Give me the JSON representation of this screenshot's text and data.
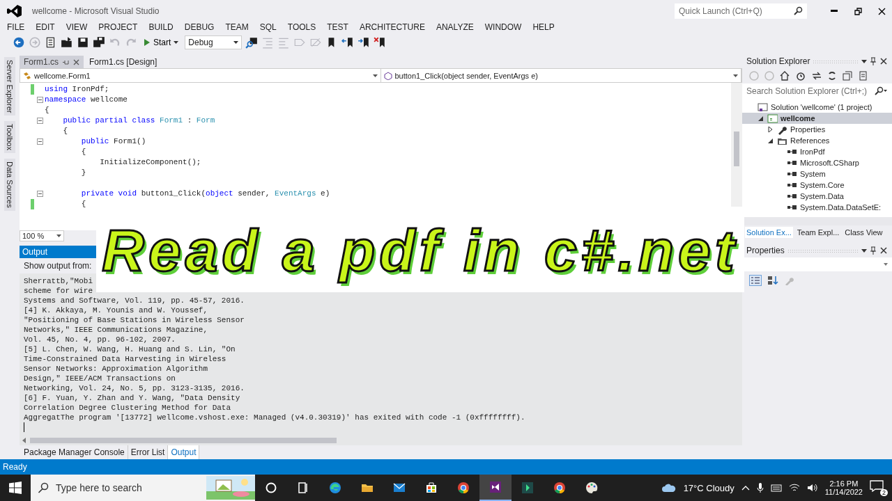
{
  "window": {
    "title": "wellcome - Microsoft Visual Studio",
    "quick_launch": {
      "placeholder": "Quick Launch (Ctrl+Q)"
    }
  },
  "menu": [
    "FILE",
    "EDIT",
    "VIEW",
    "PROJECT",
    "BUILD",
    "DEBUG",
    "TEAM",
    "SQL",
    "TOOLS",
    "TEST",
    "ARCHITECTURE",
    "ANALYZE",
    "WINDOW",
    "HELP"
  ],
  "toolbar": [
    {
      "kind": "back",
      "disabled": false
    },
    {
      "kind": "forward",
      "disabled": true
    },
    {
      "kind": "new-project",
      "disabled": false
    },
    {
      "kind": "open",
      "disabled": false
    },
    {
      "kind": "save",
      "disabled": false
    },
    {
      "kind": "save-all",
      "disabled": false
    },
    {
      "kind": "undo",
      "disabled": true
    },
    {
      "kind": "redo",
      "disabled": true
    },
    {
      "kind": "start",
      "label": "Start"
    },
    {
      "kind": "config",
      "value": "Debug"
    },
    {
      "kind": "find",
      "disabled": false
    },
    {
      "kind": "indent",
      "disabled": true
    },
    {
      "kind": "outdent",
      "disabled": true
    },
    {
      "kind": "comment",
      "disabled": true
    },
    {
      "kind": "uncomment",
      "disabled": true
    },
    {
      "kind": "bookmark",
      "disabled": false
    },
    {
      "kind": "bookmark-prev",
      "disabled": false
    },
    {
      "kind": "bookmark-next",
      "disabled": false
    },
    {
      "kind": "bookmark-clear",
      "disabled": false
    }
  ],
  "side_tabs": [
    "Server Explorer",
    "Toolbox",
    "Data Sources"
  ],
  "editor": {
    "tabs": [
      {
        "label": "Form1.cs",
        "selected": true
      },
      {
        "label": "Form1.cs [Design]",
        "selected": false
      }
    ],
    "type_dropdown": "wellcome.Form1",
    "member_dropdown": "button1_Click(object sender, EventArgs e)",
    "lines": [
      {
        "changed": true,
        "fold": false,
        "tokens": [
          {
            "text": "using",
            "kind": "keyword"
          },
          {
            "text": " IronPdf;",
            "kind": "plain"
          }
        ]
      },
      {
        "changed": false,
        "fold": true,
        "tokens": [
          {
            "text": "namespace",
            "kind": "keyword"
          },
          {
            "text": " wellcome",
            "kind": "plain"
          }
        ]
      },
      {
        "changed": false,
        "fold": false,
        "tokens": [
          {
            "text": "{",
            "kind": "plain"
          }
        ]
      },
      {
        "changed": false,
        "fold": true,
        "tokens": [
          {
            "text": "    public partial class ",
            "kind": "keyword"
          },
          {
            "text": "Form1",
            "kind": "type"
          },
          {
            "text": " : ",
            "kind": "plain"
          },
          {
            "text": "Form",
            "kind": "type"
          }
        ]
      },
      {
        "changed": false,
        "fold": false,
        "tokens": [
          {
            "text": "    {",
            "kind": "plain"
          }
        ]
      },
      {
        "changed": false,
        "fold": true,
        "tokens": [
          {
            "text": "        public ",
            "kind": "keyword"
          },
          {
            "text": "Form1()",
            "kind": "plain"
          }
        ]
      },
      {
        "changed": false,
        "fold": false,
        "tokens": [
          {
            "text": "        {",
            "kind": "plain"
          }
        ]
      },
      {
        "changed": false,
        "fold": false,
        "tokens": [
          {
            "text": "            InitializeComponent();",
            "kind": "plain"
          }
        ]
      },
      {
        "changed": false,
        "fold": false,
        "tokens": [
          {
            "text": "        }",
            "kind": "plain"
          }
        ]
      },
      {
        "changed": false,
        "fold": false
      },
      {
        "changed": false,
        "fold": true,
        "tokens": [
          {
            "text": "        private void ",
            "kind": "keyword"
          },
          {
            "text": "button1_Click(",
            "kind": "plain"
          },
          {
            "text": "object",
            "kind": "keyword"
          },
          {
            "text": " sender, ",
            "kind": "plain"
          },
          {
            "text": "EventArgs",
            "kind": "type"
          },
          {
            "text": " e)",
            "kind": "plain"
          }
        ]
      },
      {
        "changed": true,
        "fold": false,
        "tokens": [
          {
            "text": "        {",
            "kind": "plain"
          }
        ]
      }
    ],
    "zoom": "100 %"
  },
  "output": {
    "title": "Output",
    "show_output_from": "Show output from:",
    "lines": [
      "Sherrattb,\"Mobi",
      "scheme for wire",
      "Systems and Software, Vol. 119, pp. 45-57, 2016.",
      "[4] K. Akkaya, M. Younis and W. Youssef,",
      "\"Positioning of Base Stations in Wireless Sensor",
      "Networks,\" IEEE Communications Magazine,",
      "Vol. 45, No. 4, pp. 96-102, 2007.",
      "[5] L. Chen, W. Wang, H. Huang and S. Lin, \"On",
      "Time-Constrained Data Harvesting in Wireless",
      "Sensor Networks: Approximation Algorithm",
      "Design,\" IEEE/ACM Transactions on",
      "Networking, Vol. 24, No. 5, pp. 3123-3135, 2016.",
      "[6] F. Yuan, Y. Zhan and Y. Wang, \"Data Density",
      "Correlation Degree Clustering Method for Data",
      "AggregatThe program '[13772] wellcome.vshost.exe: Managed (v4.0.30319)' has exited with code -1 (0xffffffff)."
    ],
    "tabs": [
      {
        "label": "Package Manager Console",
        "selected": false
      },
      {
        "label": "Error List",
        "selected": false
      },
      {
        "label": "Output",
        "selected": true
      }
    ]
  },
  "solution_explorer": {
    "title": "Solution Explorer",
    "search": {
      "placeholder": "Search Solution Explorer (Ctrl+;)"
    },
    "tree": [
      {
        "label": "Solution 'wellcome' (1 project)",
        "kind": "solution",
        "selected": false,
        "children": [
          {
            "label": "wellcome",
            "kind": "csproject",
            "selected": true,
            "expanded": true,
            "children": [
              {
                "label": "Properties",
                "kind": "properties",
                "selected": false,
                "expanded": false
              },
              {
                "label": "References",
                "kind": "references",
                "selected": false,
                "expanded": true,
                "children": [
                  {
                    "label": "IronPdf",
                    "kind": "reference",
                    "selected": false
                  },
                  {
                    "label": "Microsoft.CSharp",
                    "kind": "reference",
                    "selected": false
                  },
                  {
                    "label": "System",
                    "kind": "reference",
                    "selected": false
                  },
                  {
                    "label": "System.Core",
                    "kind": "reference",
                    "selected": false
                  },
                  {
                    "label": "System.Data",
                    "kind": "reference",
                    "selected": false
                  },
                  {
                    "label": "System.Data.DataSetE:",
                    "kind": "reference",
                    "selected": false
                  }
                ]
              }
            ]
          }
        ]
      }
    ],
    "tabs": [
      {
        "label": "Solution Ex...",
        "selected": true
      },
      {
        "label": "Team Expl...",
        "selected": false
      },
      {
        "label": "Class View",
        "selected": false
      }
    ]
  },
  "properties": {
    "title": "Properties"
  },
  "overlay": {
    "title": "Read a pdf in c#.net"
  },
  "status_bar": "Ready",
  "taskbar": {
    "search": {
      "placeholder": "Type here to search"
    },
    "apps": [
      {
        "kind": "cortana",
        "selected": false
      },
      {
        "kind": "task-view",
        "selected": false
      },
      {
        "kind": "edge",
        "selected": false
      },
      {
        "kind": "folder",
        "selected": false
      },
      {
        "kind": "mail",
        "selected": false
      },
      {
        "kind": "store",
        "selected": false
      },
      {
        "kind": "chrome",
        "selected": false
      },
      {
        "kind": "visual-studio",
        "selected": true
      },
      {
        "kind": "app",
        "selected": false
      },
      {
        "kind": "chrome",
        "selected": false
      },
      {
        "kind": "paint",
        "selected": false
      }
    ],
    "weather": "17°C Cloudy",
    "time": "2:16 PM",
    "date": "11/14/2022",
    "notifications": "2"
  }
}
